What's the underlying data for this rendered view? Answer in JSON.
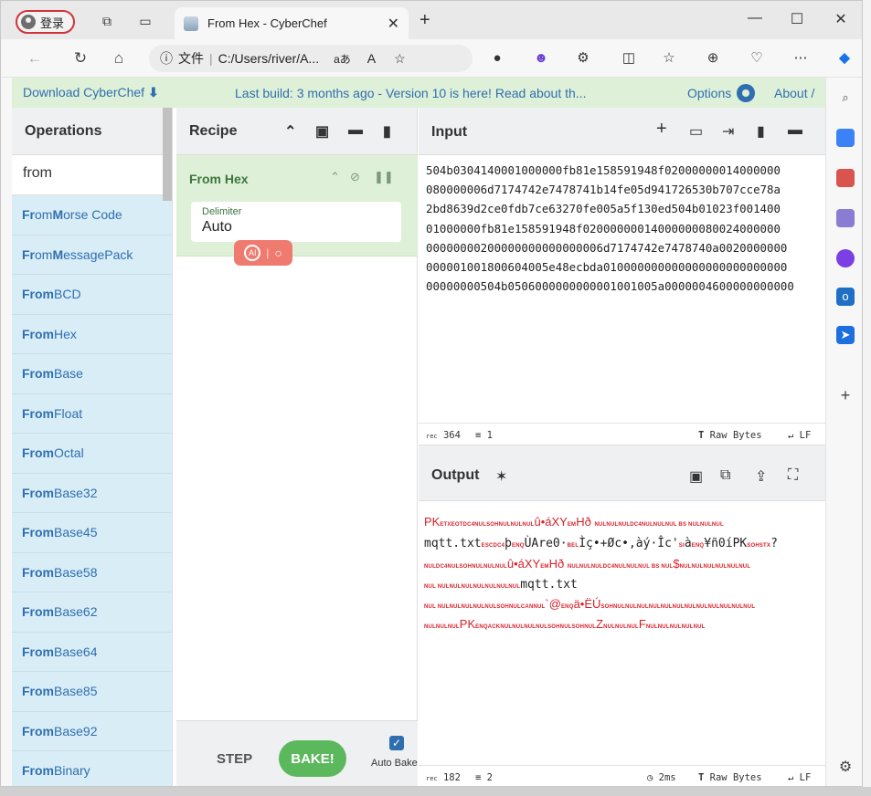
{
  "browser": {
    "profile_label": "登录",
    "tab_title": "From Hex - CyberChef",
    "address_prefix": "文件",
    "address_url": "C:/Users/river/A...",
    "address_read_aloud": "aあ"
  },
  "banner": {
    "download": "Download CyberChef",
    "last_build": "Last build: 3 months ago - Version 10 is here! Read about th...",
    "options": "Options",
    "about": "About /"
  },
  "operations": {
    "title": "Operations",
    "search_value": "from",
    "items": [
      {
        "bold": "Fr",
        "rest1": "om ",
        "bold2": "M",
        "rest2": "orse Code"
      },
      {
        "bold": "Fr",
        "rest1": "om ",
        "bold2": "M",
        "rest2": "essagePack"
      },
      {
        "bold": "From",
        "rest1": " BCD",
        "bold2": "",
        "rest2": ""
      },
      {
        "bold": "From",
        "rest1": " Hex",
        "bold2": "",
        "rest2": ""
      },
      {
        "bold": "From",
        "rest1": " Base",
        "bold2": "",
        "rest2": ""
      },
      {
        "bold": "From",
        "rest1": " Float",
        "bold2": "",
        "rest2": ""
      },
      {
        "bold": "From",
        "rest1": " Octal",
        "bold2": "",
        "rest2": ""
      },
      {
        "bold": "From",
        "rest1": " Base32",
        "bold2": "",
        "rest2": ""
      },
      {
        "bold": "From",
        "rest1": " Base45",
        "bold2": "",
        "rest2": ""
      },
      {
        "bold": "From",
        "rest1": " Base58",
        "bold2": "",
        "rest2": ""
      },
      {
        "bold": "From",
        "rest1": " Base62",
        "bold2": "",
        "rest2": ""
      },
      {
        "bold": "From",
        "rest1": " Base64",
        "bold2": "",
        "rest2": ""
      },
      {
        "bold": "From",
        "rest1": " Base85",
        "bold2": "",
        "rest2": ""
      },
      {
        "bold": "From",
        "rest1": " Base92",
        "bold2": "",
        "rest2": ""
      },
      {
        "bold": "From",
        "rest1": " Binary",
        "bold2": "",
        "rest2": ""
      }
    ]
  },
  "recipe": {
    "title": "Recipe",
    "operation": "From Hex",
    "delimiter_label": "Delimiter",
    "delimiter_value": "Auto",
    "ai_label": "AI",
    "step": "STEP",
    "bake": "BAKE!",
    "auto_bake": "Auto Bake",
    "auto_bake_checked": true
  },
  "input": {
    "title": "Input",
    "lines": [
      "504b0304140001000000fb81e158591948f02000000014000000",
      "080000006d7174742e7478741b14fe05d941726530b707cce78a",
      "2bd8639d2ce0fdb7ce63270fe005a5f130ed504b01023f001400",
      "01000000fb81e158591948f02000000014000000080024000000",
      "00000000200000000000000006d7174742e7478740a0020000000",
      "000001001800604005e48ecbda010000000000000000000000000",
      "00000000504b0506000000000001001005a0000004600000000000"
    ],
    "length_label": "rec",
    "length": "364",
    "lines_count": "1",
    "format": "Raw Bytes",
    "eol": "LF"
  },
  "output": {
    "title": "Output",
    "lines": [
      [
        {
          "t": "PK",
          "c": "big"
        },
        {
          "t": "ETXEOTDC4NULSOHNULNULNUL",
          "c": "ctrl"
        },
        {
          "t": "û•áXY",
          "c": "big"
        },
        {
          "t": "EM",
          "c": "ctrl"
        },
        {
          "t": "Hð ",
          "c": "big"
        },
        {
          "t": " NULNULNULDC4NULNULNUL BS NULNULNUL",
          "c": "ctrl"
        }
      ],
      [
        {
          "t": "mqtt.txt",
          "c": "big"
        },
        {
          "t": "ESCDC4",
          "c": "ctrl"
        },
        {
          "t": "þ",
          "c": "big"
        },
        {
          "t": "ENQ",
          "c": "ctrl"
        },
        {
          "t": "ÙAre0·",
          "c": "big"
        },
        {
          "t": "BEL",
          "c": "ctrl"
        },
        {
          "t": "Ìç•+Øc•,àý·Îc'",
          "c": "big"
        },
        {
          "t": "SI",
          "c": "ctrl"
        },
        {
          "t": "à",
          "c": "big"
        },
        {
          "t": "ENQ",
          "c": "ctrl"
        },
        {
          "t": "¥ñ0íPK",
          "c": "big"
        },
        {
          "t": "SOHSTX",
          "c": "ctrl"
        },
        {
          "t": "?",
          "c": "big"
        }
      ],
      [
        {
          "t": "NULDC4NULSOHNULNULNUL",
          "c": "ctrl"
        },
        {
          "t": "û•áXY",
          "c": "big"
        },
        {
          "t": "EM",
          "c": "ctrl"
        },
        {
          "t": "Hð ",
          "c": "big"
        },
        {
          "t": "NULNULNULDC4NULNULNUL BS NUL",
          "c": "ctrl"
        },
        {
          "t": "$",
          "c": "big"
        },
        {
          "t": "NULNULNULNULNULNUL",
          "c": "ctrl"
        }
      ],
      [
        {
          "t": "NUL  NULNULNULNULNULNULNUL",
          "c": "ctrl"
        },
        {
          "t": "mqtt.txt",
          "c": "big"
        }
      ],
      [
        {
          "t": "NUL  NULNULNULNULNULSOHNULCANNUL",
          "c": "ctrl"
        },
        {
          "t": "`@",
          "c": "big"
        },
        {
          "t": "ENQ",
          "c": "ctrl"
        },
        {
          "t": "ä•ËÚ",
          "c": "big"
        },
        {
          "t": "SOHNULNULNULNULNULNULNULNULNULNULNULNUL",
          "c": "ctrl"
        }
      ],
      [
        {
          "t": "NULNULNUL",
          "c": "ctrl"
        },
        {
          "t": "PK",
          "c": "big"
        },
        {
          "t": "ENQACKNULNULNULNULSOHNULSOHNUL",
          "c": "ctrl"
        },
        {
          "t": "Z",
          "c": "big"
        },
        {
          "t": "NULNULNUL",
          "c": "ctrl"
        },
        {
          "t": "F",
          "c": "big"
        },
        {
          "t": "NULNULNULNULNUL",
          "c": "ctrl"
        }
      ]
    ],
    "length_label": "rec",
    "length": "182",
    "lines_count": "2",
    "time": "2ms",
    "format": "Raw Bytes",
    "eol": "LF"
  }
}
